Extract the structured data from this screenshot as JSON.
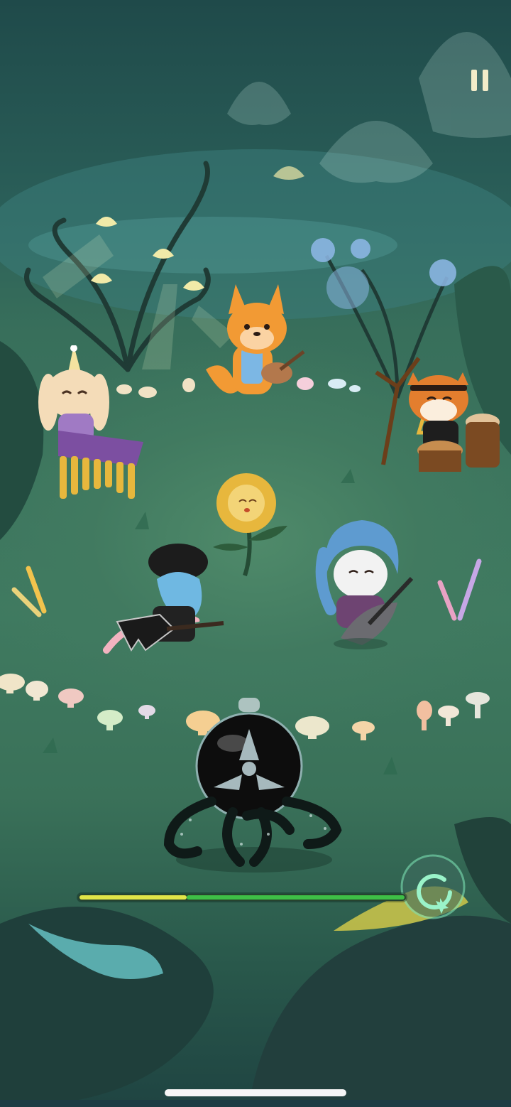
{
  "game": {
    "scene": "forest-concert",
    "progress": 0.33,
    "colors": {
      "progress_fill": "#e1e548",
      "progress_rest": "#3ebf46",
      "pause": "#f3ecc9"
    }
  },
  "icons": {
    "pause": "pause-icon",
    "combo": "star-ring-icon"
  }
}
